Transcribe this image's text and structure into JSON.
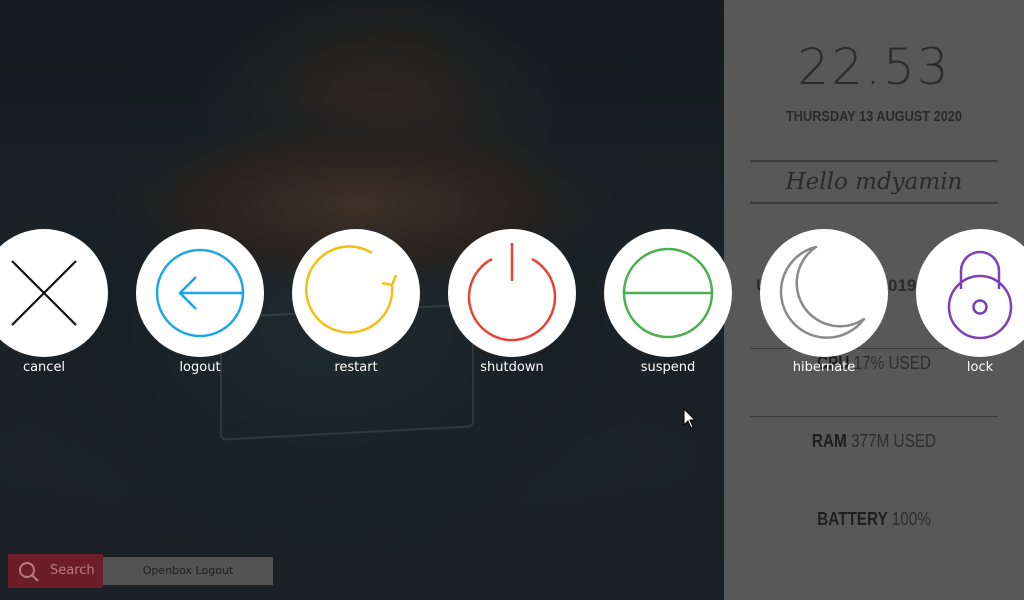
{
  "sidebar": {
    "clock": "22.53",
    "date": "THURSDAY 13 AUGUST 2020",
    "greeting": "Hello mdyamin",
    "partial_left": "U",
    "partial_right": "019",
    "cpu_label": "CPU",
    "cpu_value": "17% USED",
    "ram_label": "RAM",
    "ram_value": "377M USED",
    "battery_label": "BATTERY",
    "battery_value": "100%"
  },
  "actions": [
    {
      "label": "cancel",
      "icon": "close-icon",
      "color": "#111111"
    },
    {
      "label": "logout",
      "icon": "arrow-left-icon",
      "color": "#1ea5e6"
    },
    {
      "label": "restart",
      "icon": "restart-icon",
      "color": "#f2c012"
    },
    {
      "label": "shutdown",
      "icon": "power-icon",
      "color": "#e64336"
    },
    {
      "label": "suspend",
      "icon": "suspend-icon",
      "color": "#4caf50"
    },
    {
      "label": "hibernate",
      "icon": "moon-icon",
      "color": "#8a8a8a"
    },
    {
      "label": "lock",
      "icon": "lock-icon",
      "color": "#7e3fb8"
    }
  ],
  "bottom": {
    "search_label": "Search",
    "window_title": "Openbox Logout"
  },
  "colors": {
    "panel_bg": "#585858",
    "search_bg": "#6b1e25"
  }
}
